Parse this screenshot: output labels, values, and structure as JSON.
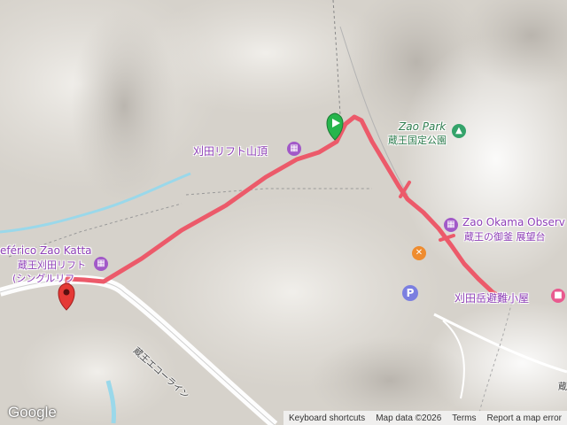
{
  "map": {
    "places": {
      "lift_summit": "刈田リフト山頂",
      "zao_park_en": "Zao Park",
      "zao_park_ja": "蔵王国定公園",
      "okama_en": "Zao Okama Observ",
      "okama_ja": "蔵王の御釜 展望台",
      "teleferico": "eférico Zao Katta",
      "katta_lift": "蔵王刈田リフト",
      "single_lift": "(シングルリフ",
      "hut": "刈田岳避難小屋",
      "road": "蔵王エコーライン",
      "edge_road": "蔵"
    },
    "icons": {
      "lift": "building-icon",
      "park": "tree-icon",
      "restaurant": "fork-knife-icon",
      "parking": "P",
      "hotel": "bed-icon",
      "start": "green-flag-marker",
      "end": "red-pin-marker"
    },
    "colors": {
      "route": "#ec5a6a",
      "poi": "#a259c8",
      "park": "#34a36a",
      "restaurant": "#ef8c2f",
      "parking": "#7b7fe0",
      "hotel": "#e95a8f",
      "water": "#8fd3e8"
    }
  },
  "branding": {
    "logo": "Google"
  },
  "footer": {
    "shortcuts": "Keyboard shortcuts",
    "map_data": "Map data ©2026",
    "terms": "Terms",
    "report": "Report a map error"
  }
}
